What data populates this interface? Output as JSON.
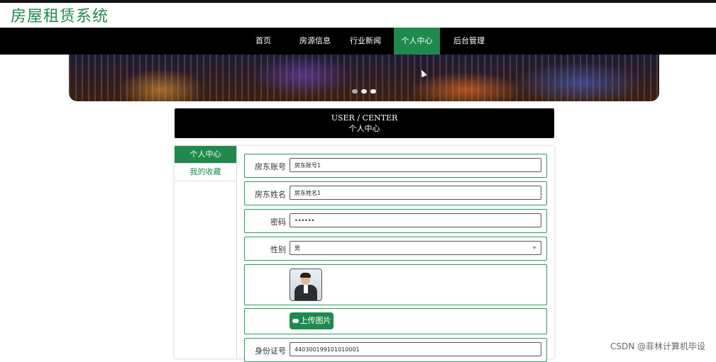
{
  "site": {
    "title": "房屋租赁系统"
  },
  "nav": {
    "items": [
      {
        "label": "首页"
      },
      {
        "label": "房源信息"
      },
      {
        "label": "行业新闻"
      },
      {
        "label": "个人中心",
        "active": true
      },
      {
        "label": "后台管理"
      }
    ]
  },
  "banner": {
    "dots": 3,
    "active_dot": 1
  },
  "user_center": {
    "title_en": "USER / CENTER",
    "title_cn": "个人中心"
  },
  "sidebar": {
    "items": [
      {
        "label": "个人中心",
        "active": true
      },
      {
        "label": "我的收藏"
      }
    ]
  },
  "form": {
    "account_label": "房东账号",
    "account_value": "房东账号1",
    "name_label": "房东姓名",
    "name_value": "房东姓名1",
    "password_label": "密码",
    "password_value": "••••••",
    "gender_label": "性别",
    "gender_value": "男",
    "avatar_icon": "person-photo",
    "upload_label": "上传图片",
    "id_label": "身份证号",
    "id_value": "440300199101010001"
  },
  "colors": {
    "accent": "#1f8a4c",
    "nav_bg": "#000000",
    "header_bg": "#000000"
  },
  "watermark": "CSDN @菲林计算机毕设"
}
